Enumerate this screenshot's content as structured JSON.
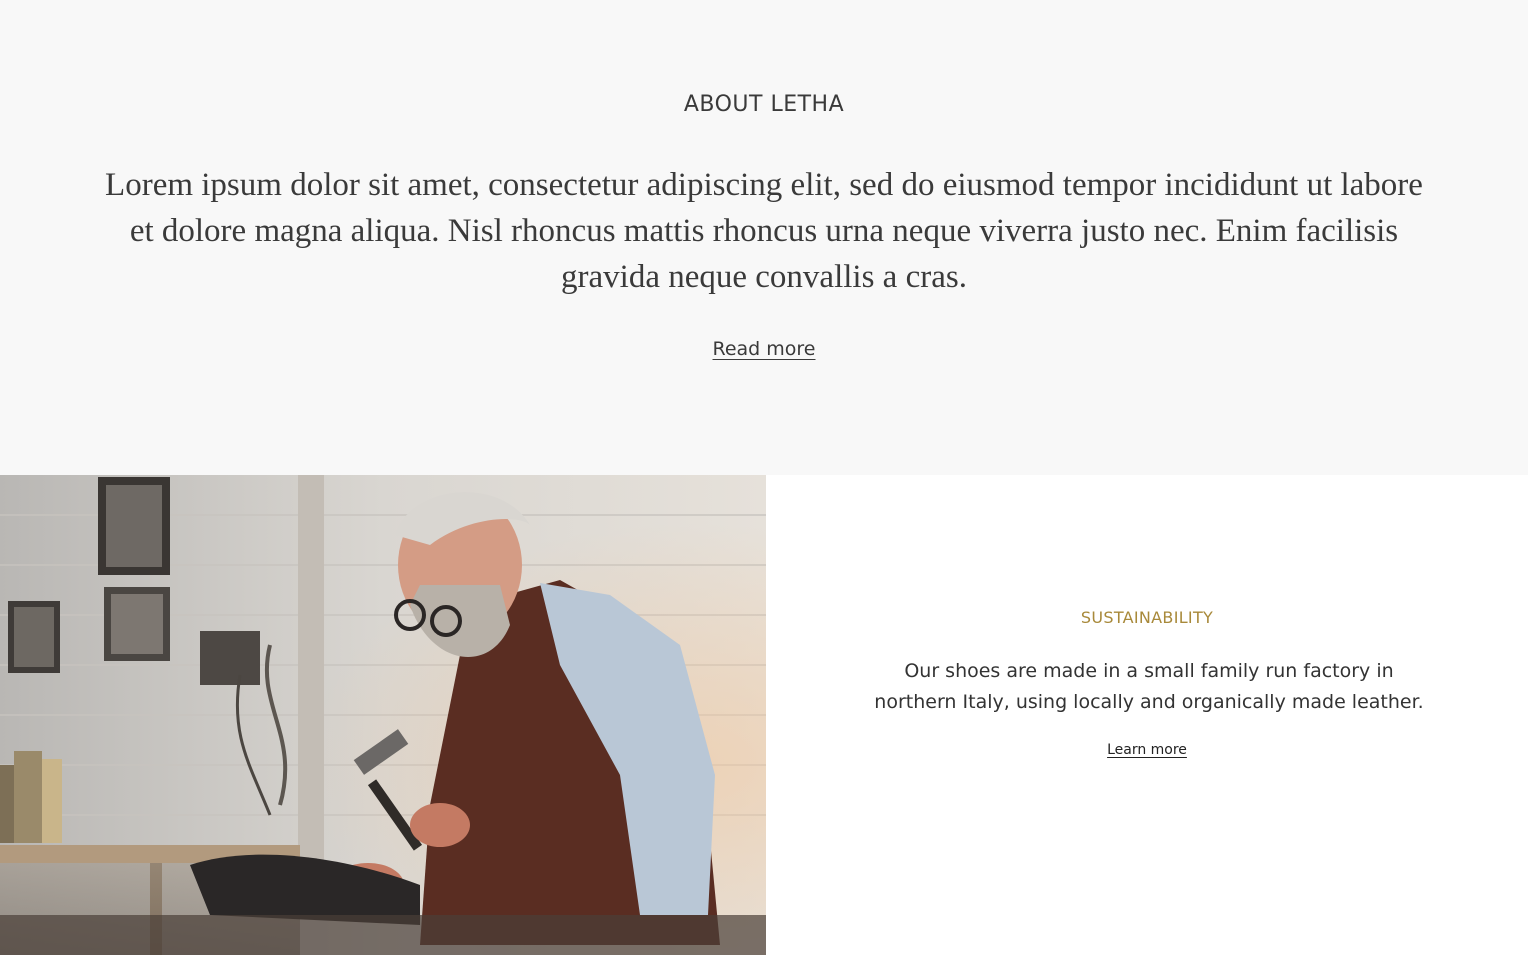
{
  "about": {
    "heading": "ABOUT LETHA",
    "body": "Lorem ipsum dolor sit amet, consectetur adipiscing elit, sed do eiusmod tempor incididunt ut labore et dolore magna aliqua. Nisl rhoncus mattis rhoncus urna neque viverra justo nec. Enim facilisis gravida neque convallis a cras.",
    "link_label": "Read more"
  },
  "feature": {
    "eyebrow": "SUSTAINABILITY",
    "text": "Our shoes are made in a small family run factory in northern Italy, using locally and organically made leather.",
    "link_label": "Learn more",
    "accent_color": "#a8893a"
  }
}
